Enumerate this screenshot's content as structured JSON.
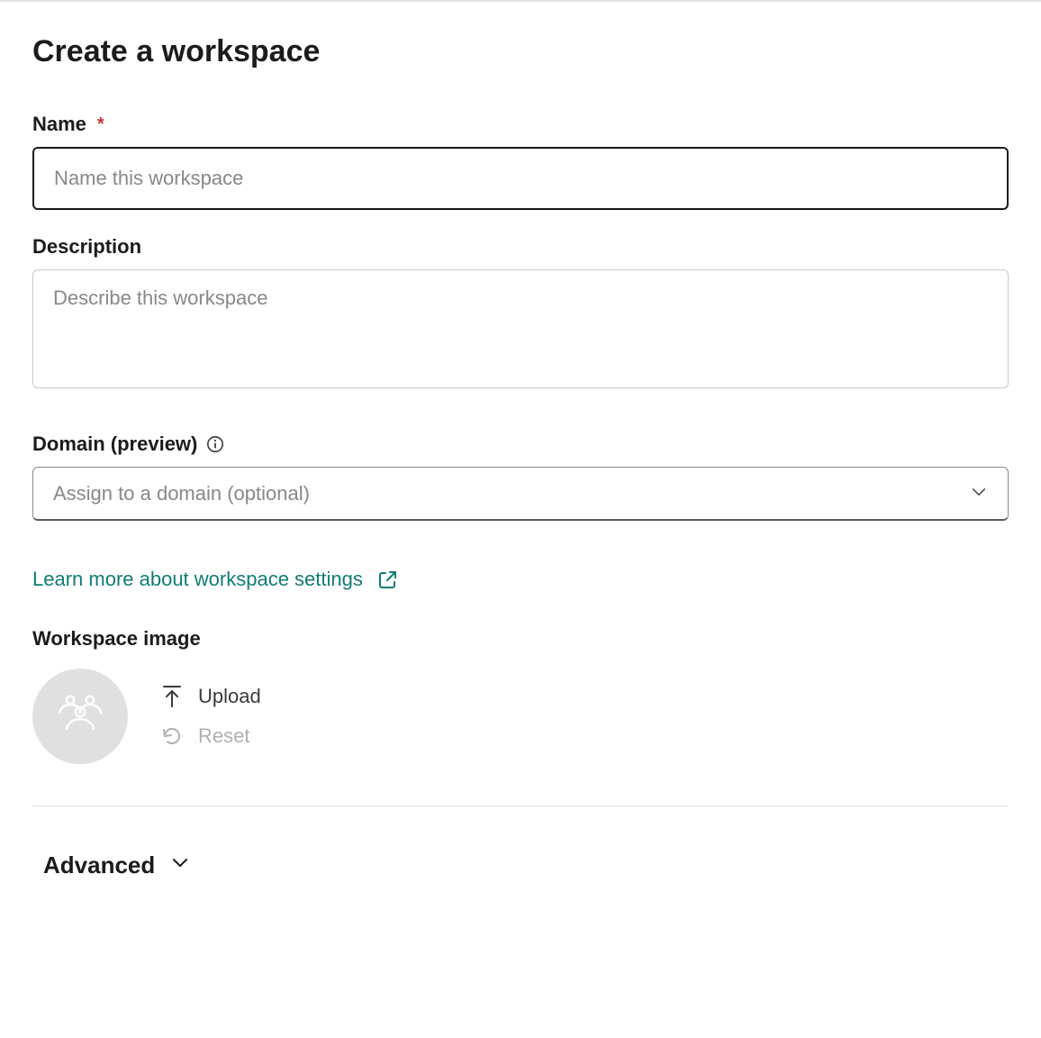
{
  "title": "Create a workspace",
  "name_field": {
    "label": "Name",
    "required_mark": "*",
    "placeholder": "Name this workspace",
    "value": ""
  },
  "description_field": {
    "label": "Description",
    "placeholder": "Describe this workspace",
    "value": ""
  },
  "domain_field": {
    "label": "Domain (preview)",
    "placeholder": "Assign to a domain (optional)",
    "value": ""
  },
  "learn_more": {
    "text": "Learn more about workspace settings"
  },
  "workspace_image": {
    "heading": "Workspace image",
    "upload_label": "Upload",
    "reset_label": "Reset"
  },
  "advanced": {
    "label": "Advanced"
  }
}
